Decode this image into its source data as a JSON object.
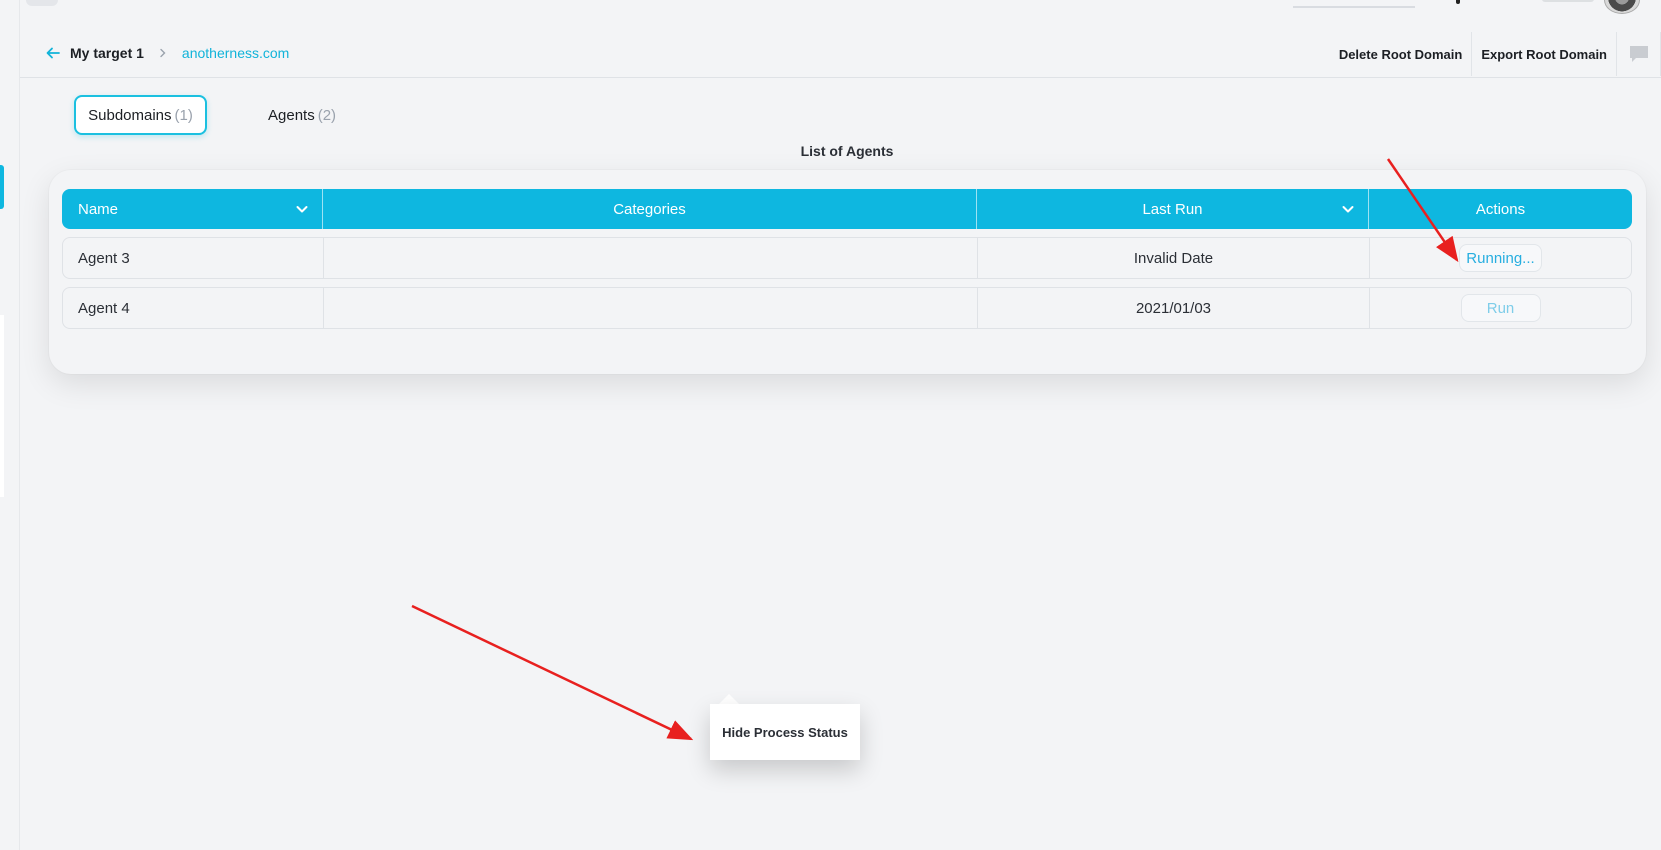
{
  "breadcrumb": {
    "target": "My target 1",
    "domain": "anotherness.com"
  },
  "actions": {
    "delete_label": "Delete Root Domain",
    "export_label": "Export Root Domain"
  },
  "tabs": [
    {
      "label": "Subdomains",
      "count": "(1)",
      "active": true
    },
    {
      "label": "Agents",
      "count": "(2)",
      "active": false
    }
  ],
  "list_title": "List of Agents",
  "table": {
    "headers": [
      "Name",
      "Categories",
      "Last Run",
      "Actions"
    ],
    "rows": [
      {
        "name": "Agent 3",
        "categories": "",
        "last_run": "Invalid Date",
        "action": "Running..."
      },
      {
        "name": "Agent 4",
        "categories": "",
        "last_run": "2021/01/03",
        "action": "Run"
      }
    ]
  },
  "popover": {
    "label": "Hide Process Status"
  },
  "colors": {
    "accent": "#0eb7e0",
    "link": "#11b3d9",
    "annotation": "#e8201f"
  },
  "icons": {
    "back": "arrow-left-icon",
    "separator": "chevron-right-icon",
    "sort": "chevron-down-icon",
    "chat": "comment-icon"
  }
}
